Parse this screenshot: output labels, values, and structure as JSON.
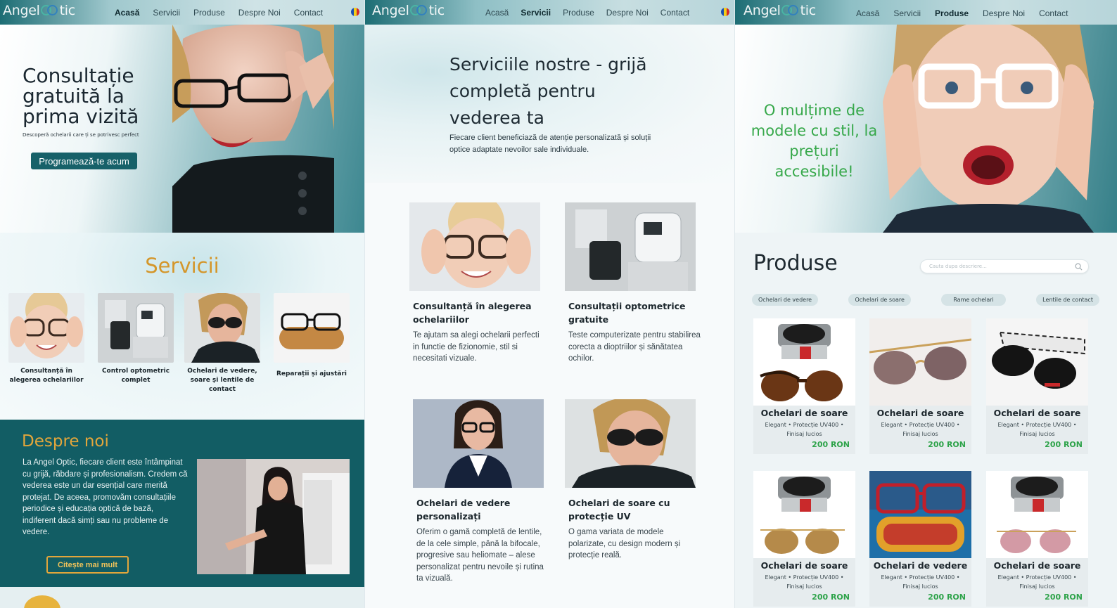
{
  "brand": {
    "logo_left": "Angel",
    "logo_right": "tic"
  },
  "nav": {
    "items": [
      "Acasă",
      "Servicii",
      "Produse",
      "Despre Noi",
      "Contact"
    ]
  },
  "colors": {
    "teal": "#125d64",
    "gold": "#d4962a",
    "green": "#36a84a",
    "price_green": "#2ea34a"
  },
  "home": {
    "hero_title": "Consultație gratuită la prima vizită",
    "hero_subtitle": "Descoperă ochelarii care ți se potrivesc perfect",
    "cta": "Programează-te acum",
    "services_title": "Servicii",
    "services": [
      "Consultanță în alegerea ochelariilor",
      "Control optometric complet",
      "Ochelari de vedere,  soare și lentile de contact",
      "Reparații și ajustări"
    ],
    "about_title": "Despre noi",
    "about_text": "La Angel Optic, fiecare client este întâmpinat cu grijă, răbdare și profesionalism. Credem că vederea este un dar esențial care merită protejat. De aceea, promovăm consultațiile periodice și educația optică de bază, indiferent dacă simți sau nu probleme de vedere.",
    "about_cta": "Citește mai mult"
  },
  "services_page": {
    "hero_title": "Serviciile nostre - grijă completă pentru vederea ta",
    "hero_subtitle": "Fiecare client beneficiază de atenție personalizată și soluții optice adaptate nevoilor sale individuale.",
    "cards": [
      {
        "title": "Consultanță în alegerea ochelariilor",
        "text": "Te ajutam sa alegi ochelarii perfecti in functie de fizionomie, stil si necesitati vizuale."
      },
      {
        "title": "Consultații optometrice gratuite",
        "text": "Teste computerizate pentru stabilirea corecta a dioptriilor și sănătatea ochilor."
      },
      {
        "title": "Ochelari de vedere personalizați",
        "text": "Oferim o gamă completă de lentile, de la cele simple, până la bifocale, progresive sau heliomate – alese personalizat pentru nevoile și rutina ta vizuală."
      },
      {
        "title": "Ochelari de soare cu protecție UV",
        "text": "O gama variata de modele polarizate, cu design modern și protecție reală."
      }
    ]
  },
  "products_page": {
    "hero_title": "O mulțime de modele cu stil, la prețuri accesibile!",
    "title": "Produse",
    "search_placeholder": "Cauta dupa descriere...",
    "filters": [
      "Ochelari de vedere",
      "Ochelari de soare",
      "Rame ochelari",
      "Lentile de contact"
    ],
    "products": [
      {
        "title": "Ochelari de soare",
        "desc": "Elegant • Protecție UV400 • Finisaj lucios",
        "price": "200 RON",
        "kind": "case-brown"
      },
      {
        "title": "Ochelari de soare",
        "desc": "Elegant • Protecție UV400 • Finisaj lucios",
        "price": "200 RON",
        "kind": "aviator-gold"
      },
      {
        "title": "Ochelari de soare",
        "desc": "Elegant • Protecție UV400 • Finisaj lucios",
        "price": "200 RON",
        "kind": "black-pattern"
      },
      {
        "title": "Ochelari de soare",
        "desc": "Elegant • Protecție UV400 • Finisaj lucios",
        "price": "200 RON",
        "kind": "case-aviator"
      },
      {
        "title": "Ochelari de vedere",
        "desc": "Elegant • Protecție UV400 • Finisaj lucios",
        "price": "200 RON",
        "kind": "red-frame"
      },
      {
        "title": "Ochelari de soare",
        "desc": "Elegant • Protecție UV400 • Finisaj lucios",
        "price": "200 RON",
        "kind": "case-pink"
      }
    ]
  }
}
